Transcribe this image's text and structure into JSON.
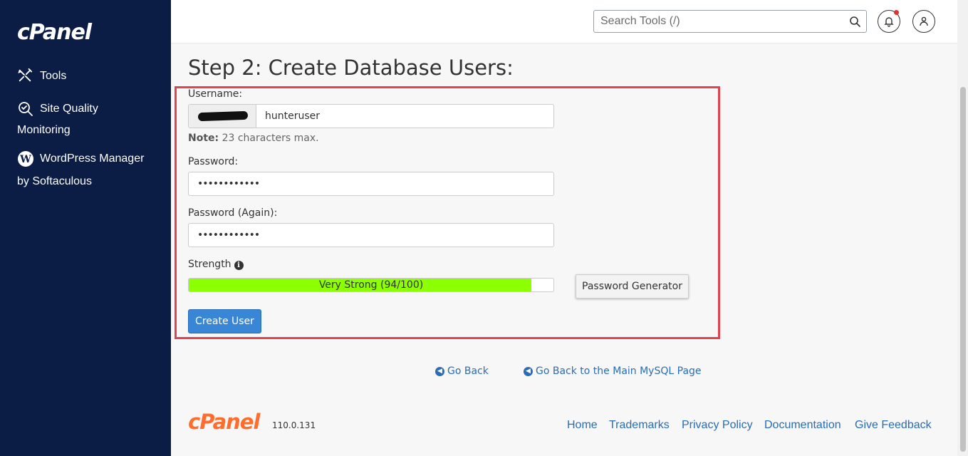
{
  "sidebar": {
    "logo": "cPanel",
    "items": [
      {
        "label": "Tools",
        "icon": "tools-icon"
      },
      {
        "label_line1": "Site Quality",
        "label_line2": "Monitoring",
        "icon": "site-quality-icon"
      },
      {
        "label_line1": "WordPress Manager",
        "label_line2": "by Softaculous",
        "icon": "wordpress-icon"
      }
    ]
  },
  "header": {
    "search_placeholder": "Search Tools (/)"
  },
  "main": {
    "title": "Step 2: Create Database Users:",
    "username_label": "Username:",
    "username_value": "hunteruser",
    "note_bold": "Note:",
    "note_text": " 23 characters max.",
    "password_label": "Password:",
    "password_value": "••••••••••••",
    "password_again_label": "Password (Again):",
    "password_again_value": "••••••••••••",
    "strength_label": "Strength",
    "strength_text": "Very Strong (94/100)",
    "strength_value": 94,
    "password_generator_label": "Password Generator",
    "create_user_label": "Create User",
    "go_back_label": "Go Back",
    "go_back_main_label": "Go Back to the Main MySQL Page"
  },
  "footer": {
    "logo": "cPanel",
    "version": "110.0.131",
    "links": [
      "Home",
      "Trademarks",
      "Privacy Policy",
      "Documentation",
      "Give Feedback"
    ]
  },
  "colors": {
    "sidebar_bg": "#0b1c45",
    "accent_blue": "#3a86d6",
    "link_blue": "#2a6cb5",
    "strength_green": "#8cff00",
    "highlight_red": "#e0454f",
    "brand_orange": "#ff6c2c"
  }
}
